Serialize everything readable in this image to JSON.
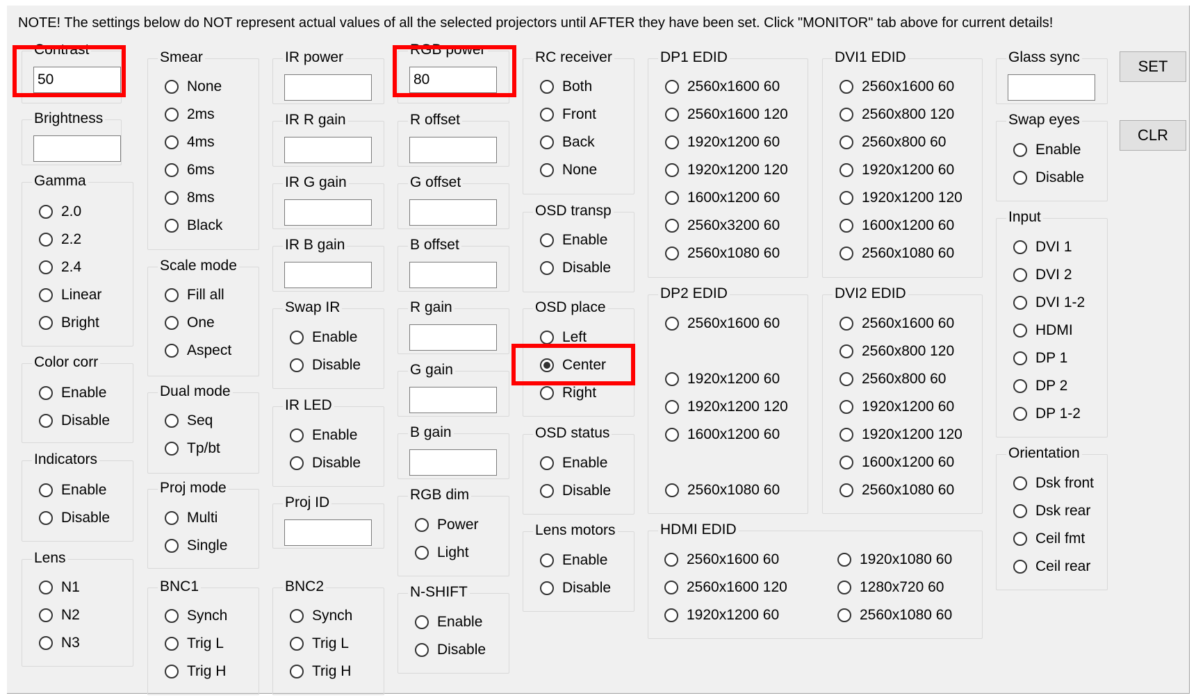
{
  "note": "NOTE! The settings below do NOT represent actual values of all the selected projectors until AFTER they have been set. Click \"MONITOR\" tab above for current details!",
  "buttons": {
    "set": "SET",
    "clr": "CLR"
  },
  "groups": {
    "contrast": {
      "title": "Contrast",
      "value": "50"
    },
    "brightness": {
      "title": "Brightness",
      "value": ""
    },
    "gamma": {
      "title": "Gamma",
      "options": [
        "2.0",
        "2.2",
        "2.4",
        "Linear",
        "Bright"
      ]
    },
    "color_corr": {
      "title": "Color corr",
      "options": [
        "Enable",
        "Disable"
      ]
    },
    "indicators": {
      "title": "Indicators",
      "options": [
        "Enable",
        "Disable"
      ]
    },
    "lens": {
      "title": "Lens",
      "options": [
        "N1",
        "N2",
        "N3"
      ]
    },
    "smear": {
      "title": "Smear",
      "options": [
        "None",
        "2ms",
        "4ms",
        "6ms",
        "8ms",
        "Black"
      ]
    },
    "scale_mode": {
      "title": "Scale mode",
      "options": [
        "Fill all",
        "One",
        "Aspect"
      ]
    },
    "dual_mode": {
      "title": "Dual mode",
      "options": [
        "Seq",
        "Tp/bt"
      ]
    },
    "proj_mode": {
      "title": "Proj mode",
      "options": [
        "Multi",
        "Single"
      ]
    },
    "bnc1": {
      "title": "BNC1",
      "options": [
        "Synch",
        "Trig L",
        "Trig H"
      ]
    },
    "ir_power": {
      "title": "IR power",
      "value": ""
    },
    "ir_r_gain": {
      "title": "IR R gain",
      "value": ""
    },
    "ir_g_gain": {
      "title": "IR G gain",
      "value": ""
    },
    "ir_b_gain": {
      "title": "IR B gain",
      "value": ""
    },
    "swap_ir": {
      "title": "Swap IR",
      "options": [
        "Enable",
        "Disable"
      ]
    },
    "ir_led": {
      "title": "IR LED",
      "options": [
        "Enable",
        "Disable"
      ]
    },
    "proj_id": {
      "title": "Proj ID",
      "value": ""
    },
    "bnc2": {
      "title": "BNC2",
      "options": [
        "Synch",
        "Trig L",
        "Trig H"
      ]
    },
    "rgb_power": {
      "title": "RGB power",
      "value": "80"
    },
    "r_offset": {
      "title": "R offset",
      "value": ""
    },
    "g_offset": {
      "title": "G offset",
      "value": ""
    },
    "b_offset": {
      "title": "B offset",
      "value": ""
    },
    "r_gain": {
      "title": "R gain",
      "value": ""
    },
    "g_gain": {
      "title": "G gain",
      "value": ""
    },
    "b_gain": {
      "title": "B gain",
      "value": ""
    },
    "rgb_dim": {
      "title": "RGB dim",
      "options": [
        "Power",
        "Light"
      ]
    },
    "n_shift": {
      "title": "N-SHIFT",
      "options": [
        "Enable",
        "Disable"
      ]
    },
    "rc_receiver": {
      "title": "RC receiver",
      "options": [
        "Both",
        "Front",
        "Back",
        "None"
      ]
    },
    "osd_transp": {
      "title": "OSD transp",
      "options": [
        "Enable",
        "Disable"
      ]
    },
    "osd_place": {
      "title": "OSD place",
      "options": [
        "Left",
        "Center",
        "Right"
      ],
      "selected": "Center"
    },
    "osd_status": {
      "title": "OSD status",
      "options": [
        "Enable",
        "Disable"
      ]
    },
    "lens_motors": {
      "title": "Lens motors",
      "options": [
        "Enable",
        "Disable"
      ]
    },
    "dp1_edid": {
      "title": "DP1 EDID",
      "options": [
        "2560x1600 60",
        "2560x1600 120",
        "1920x1200 60",
        "1920x1200 120",
        "1600x1200 60",
        "2560x3200 60",
        "2560x1080 60"
      ]
    },
    "dp2_edid": {
      "title": "DP2 EDID",
      "options": [
        "2560x1600 60",
        "1920x1200 60",
        "1920x1200 120",
        "1600x1200 60",
        "2560x1080 60"
      ]
    },
    "dvi1_edid": {
      "title": "DVI1 EDID",
      "options": [
        "2560x1600 60",
        "2560x800 120",
        "2560x800 60",
        "1920x1200 60",
        "1920x1200 120",
        "1600x1200 60",
        "2560x1080 60"
      ]
    },
    "dvi2_edid": {
      "title": "DVI2 EDID",
      "options": [
        "2560x1600 60",
        "2560x800 120",
        "2560x800 60",
        "1920x1200 60",
        "1920x1200 120",
        "1600x1200 60",
        "2560x1080 60"
      ]
    },
    "hdmi_edid": {
      "title": "HDMI EDID",
      "options": [
        "2560x1600 60",
        "2560x1600 120",
        "1920x1200 60",
        "1920x1080 60",
        "1280x720 60",
        "2560x1080 60"
      ]
    },
    "glass_sync": {
      "title": "Glass sync",
      "value": ""
    },
    "swap_eyes": {
      "title": "Swap eyes",
      "options": [
        "Enable",
        "Disable"
      ]
    },
    "input": {
      "title": "Input",
      "options": [
        "DVI 1",
        "DVI 2",
        "DVI 1-2",
        "HDMI",
        "DP 1",
        "DP 2",
        "DP 1-2"
      ]
    },
    "orientation": {
      "title": "Orientation",
      "options": [
        "Dsk front",
        "Dsk rear",
        "Ceil fmt",
        "Ceil rear"
      ]
    }
  },
  "highlight_color": "#ff0000",
  "icons": {
    "radio": "radio-circle-icon",
    "radio_selected": "radio-selected-icon"
  }
}
